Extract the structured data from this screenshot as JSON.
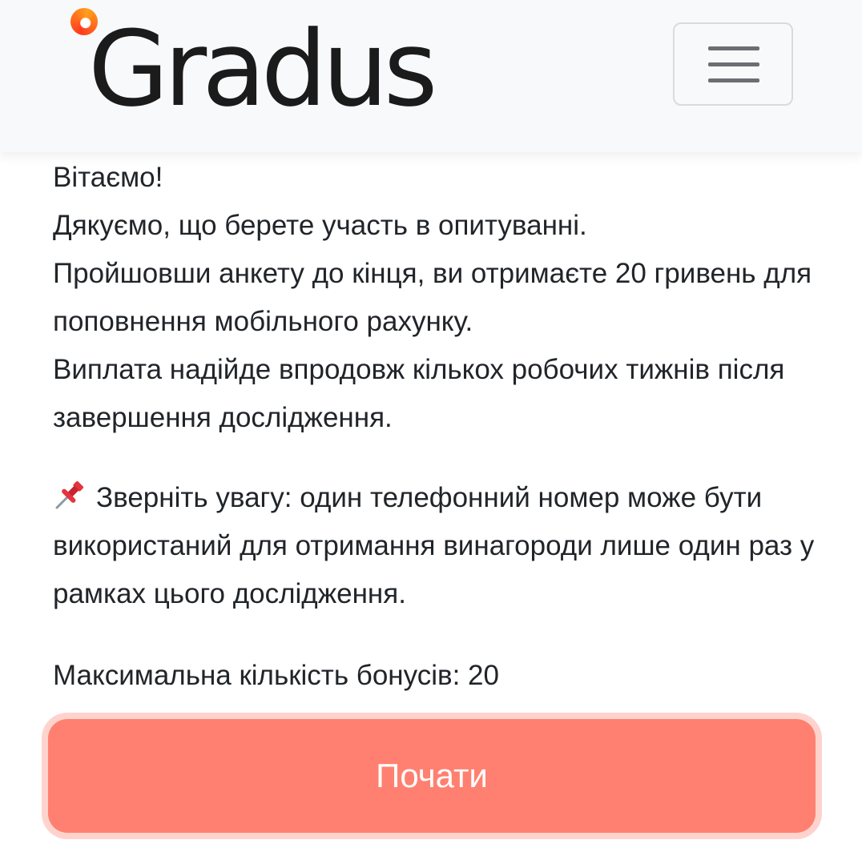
{
  "header": {
    "logo_text": "Gradus"
  },
  "intro": {
    "greeting": "Вітаємо!",
    "thanks": "Дякуємо, що берете участь в опитуванні.",
    "reward": "Пройшовши анкету до кінця, ви отримаєте 20 гривень для поповнення мобільного рахунку.",
    "payout": "Виплата надійде впродовж кількох робочих тижнів після завершення дослідження."
  },
  "notice": {
    "icon": "pushpin-icon",
    "text": "Зверніть увагу: один телефонний номер може бути використаний для отримання винагороди лише один раз у рамках цього дослідження."
  },
  "bonus": {
    "text": "Максимальна кількість бонусів: 20"
  },
  "actions": {
    "start_label": "Почати"
  },
  "colors": {
    "button": "#ff8070",
    "navbar": "#f8f9fa",
    "logo_accent": "#ff5a1f"
  }
}
